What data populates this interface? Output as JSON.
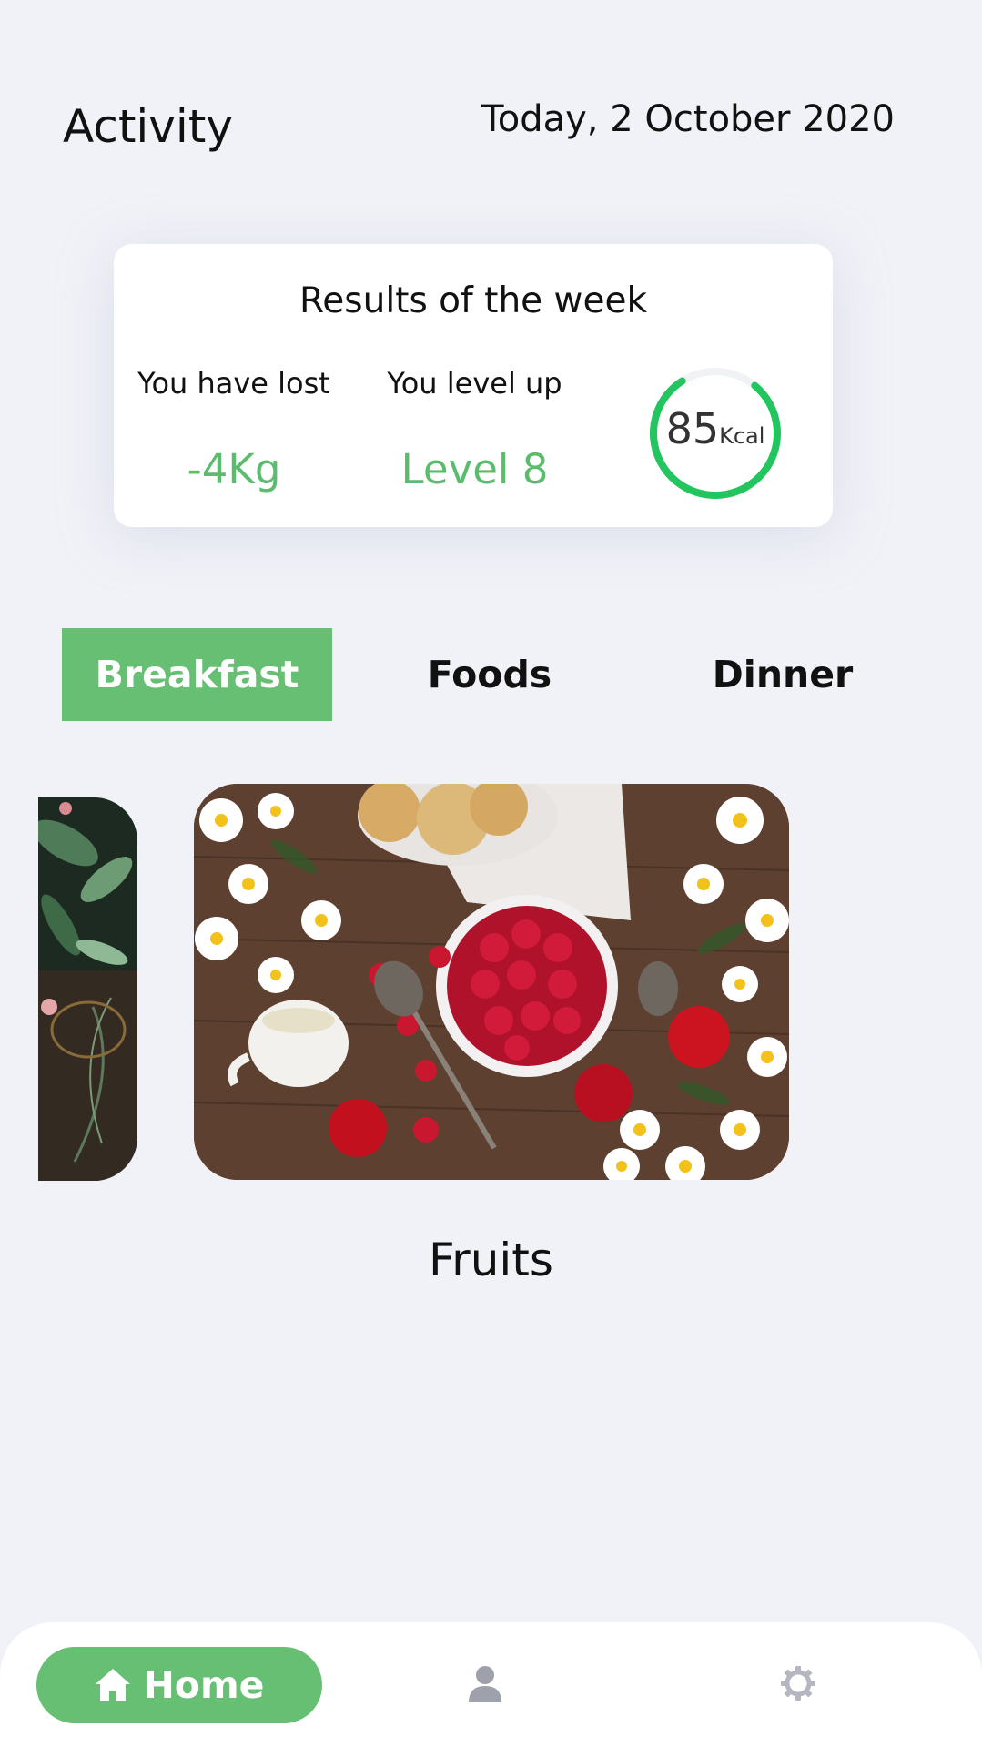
{
  "header": {
    "title": "Activity",
    "date": "Today, 2 October 2020"
  },
  "results": {
    "title": "Results of the week",
    "lost_label": "You have lost",
    "lost_value": "-4Kg",
    "level_label": "You level up",
    "level_value": "Level 8",
    "kcal_value": "85",
    "kcal_unit": "Kcal",
    "kcal_ring_progress": 0.8,
    "accent_color": "#5cbc6e",
    "ring_color": "#22c55e"
  },
  "tabs": [
    {
      "label": "Breakfast",
      "active": true
    },
    {
      "label": "Foods",
      "active": false
    },
    {
      "label": "Dinner",
      "active": false
    }
  ],
  "carousel": {
    "current_caption": "Fruits"
  },
  "bottom_nav": {
    "home_label": "Home",
    "home_icon": "home-icon",
    "profile_icon": "person-icon",
    "settings_icon": "gear-icon",
    "active_color": "#66bf73"
  }
}
